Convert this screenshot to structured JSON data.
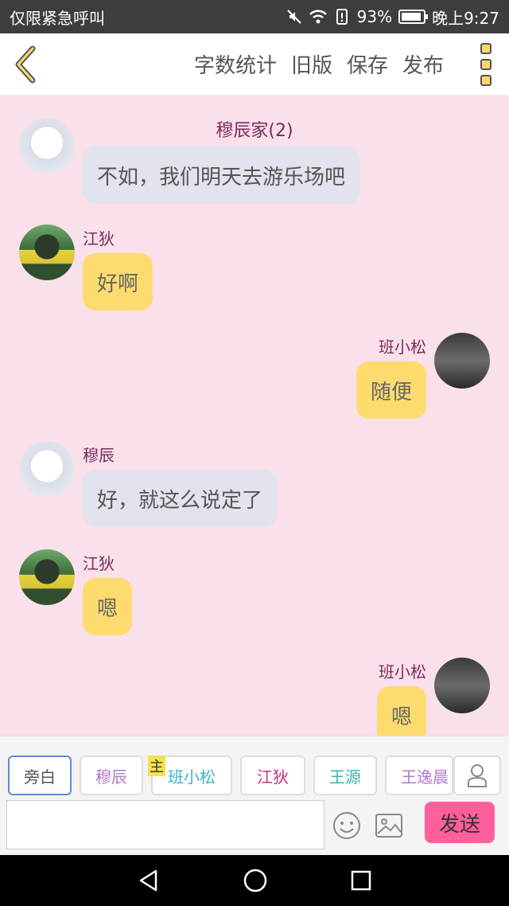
{
  "status_bar": {
    "left_text": "仅限紧急呼叫",
    "battery": "93%",
    "time": "晚上9:27",
    "battery_level": 0.93,
    "icons": [
      "mute-icon",
      "wifi-icon",
      "alert-icon",
      "battery-icon"
    ]
  },
  "toolbar": {
    "actions": [
      "字数统计",
      "旧版",
      "保存",
      "发布"
    ],
    "back_icon": "chevron-left-icon",
    "menu_icon": "vertical-menu-icon"
  },
  "chat": {
    "title": "穆辰家(2)",
    "messages": [
      {
        "sender": "",
        "text": "不如，我们明天去游乐场吧",
        "side": "left",
        "style": "gray"
      },
      {
        "sender": "江狄",
        "text": "好啊",
        "side": "left",
        "style": "yellow"
      },
      {
        "sender": "班小松",
        "text": "随便",
        "side": "right",
        "style": "yellow"
      },
      {
        "sender": "穆辰",
        "text": "好，就这么说定了",
        "side": "left",
        "style": "gray"
      },
      {
        "sender": "江狄",
        "text": "嗯",
        "side": "left",
        "style": "yellow"
      },
      {
        "sender": "班小松",
        "text": "嗯",
        "side": "right",
        "style": "yellow"
      }
    ]
  },
  "input": {
    "roles": [
      {
        "label": "旁白",
        "color": "#555555"
      },
      {
        "label": "穆辰",
        "color": "#b07ac8"
      },
      {
        "label": "班小松",
        "color": "#3bb3c3"
      },
      {
        "label": "江狄",
        "color": "#c0307a"
      },
      {
        "label": "王源",
        "color": "#3bb3a8"
      },
      {
        "label": "王逸晨",
        "color": "#b07ac8"
      }
    ],
    "host_tag": "主",
    "send_label": "发送",
    "placeholder": ""
  },
  "colors": {
    "background": "#f9e0ea",
    "bubble_gray": "#e1e3ed",
    "bubble_yellow": "#fedb6e",
    "sender_name": "#7b2c5a",
    "send_button": "#ff5f9c"
  }
}
